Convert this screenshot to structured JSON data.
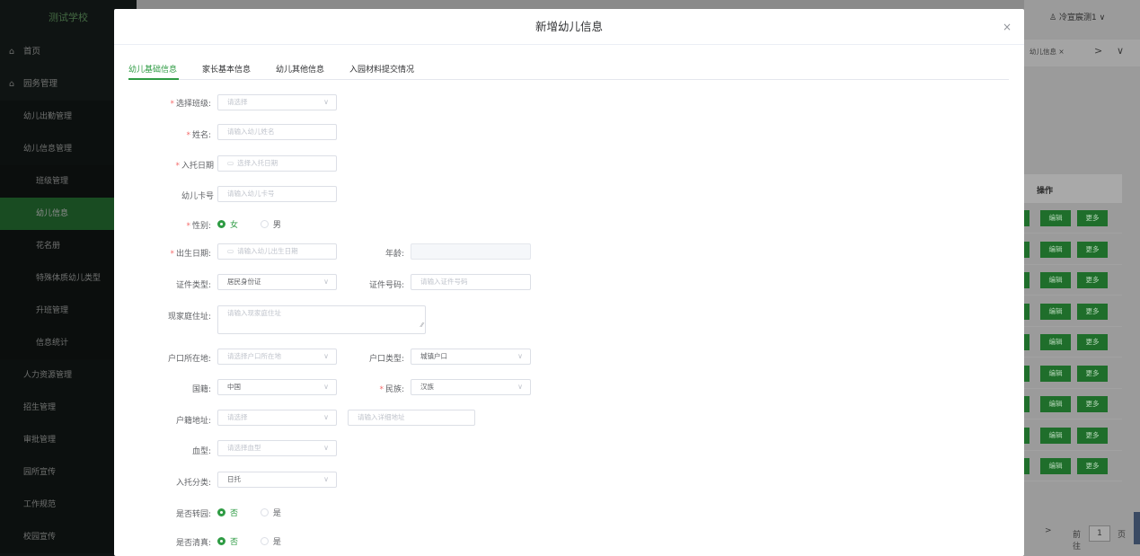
{
  "sidebar": {
    "logo": "测试学校",
    "items": [
      {
        "label": "首页",
        "icon": "⌂"
      },
      {
        "label": "园务管理",
        "icon": "⌂"
      },
      {
        "label": "幼儿出勤管理"
      },
      {
        "label": "幼儿信息管理"
      },
      {
        "label": "班级管理"
      },
      {
        "label": "幼儿信息"
      },
      {
        "label": "花名册"
      },
      {
        "label": "特殊体质幼儿类型"
      },
      {
        "label": "升班管理"
      },
      {
        "label": "信息统计"
      },
      {
        "label": "人力资源管理"
      },
      {
        "label": "招生管理"
      },
      {
        "label": "审批管理"
      },
      {
        "label": "园所宣传"
      },
      {
        "label": "工作规范"
      },
      {
        "label": "校园宣传"
      }
    ]
  },
  "header": {
    "user": "冷宣宸测1"
  },
  "tabbar": {
    "tab_label": "幼儿信息",
    "tab_close": "×",
    "next": ">",
    "more": "∨"
  },
  "table": {
    "op_header": "操作",
    "edit_label": "编辑",
    "more_label": "更多",
    "row_count": 9
  },
  "pager": {
    "next": ">",
    "goto_label": "前往",
    "page": "1",
    "page_unit": "页"
  },
  "dialog": {
    "title": "新增幼儿信息",
    "close": "×",
    "tabs": [
      "幼儿基础信息",
      "家长基本信息",
      "幼儿其他信息",
      "入园材料提交情况"
    ],
    "form": {
      "class_label": "选择班级:",
      "class_placeholder": "请选择",
      "name_label": "姓名:",
      "name_placeholder": "请输入幼儿姓名",
      "entry_date_label": "入托日期",
      "entry_date_placeholder": "选择入托日期",
      "card_label": "幼儿卡号",
      "card_placeholder": "请输入幼儿卡号",
      "gender_label": "性别:",
      "gender_female": "女",
      "gender_male": "男",
      "birth_label": "出生日期:",
      "birth_placeholder": "请输入幼儿出生日期",
      "age_label": "年龄:",
      "idtype_label": "证件类型:",
      "idtype_value": "居民身份证",
      "idno_label": "证件号码:",
      "idno_placeholder": "请输入证件号码",
      "address_label": "现家庭住址:",
      "address_placeholder": "请输入现家庭住址",
      "hukou_place_label": "户口所在地:",
      "hukou_place_placeholder": "请选择户口所在地",
      "hukou_type_label": "户口类型:",
      "hukou_type_value": "城镇户口",
      "nation_label": "国籍:",
      "nation_value": "中国",
      "ethnic_label": "民族:",
      "ethnic_value": "汉族",
      "domicile_label": "户籍地址:",
      "domicile_placeholder": "请选择",
      "domicile_detail_placeholder": "请输入详细地址",
      "blood_label": "血型:",
      "blood_placeholder": "请选择血型",
      "care_label": "入托分类:",
      "care_value": "日托",
      "transfer_label": "是否转园:",
      "halal_label": "是否清真:",
      "no": "否",
      "yes": "是"
    }
  }
}
